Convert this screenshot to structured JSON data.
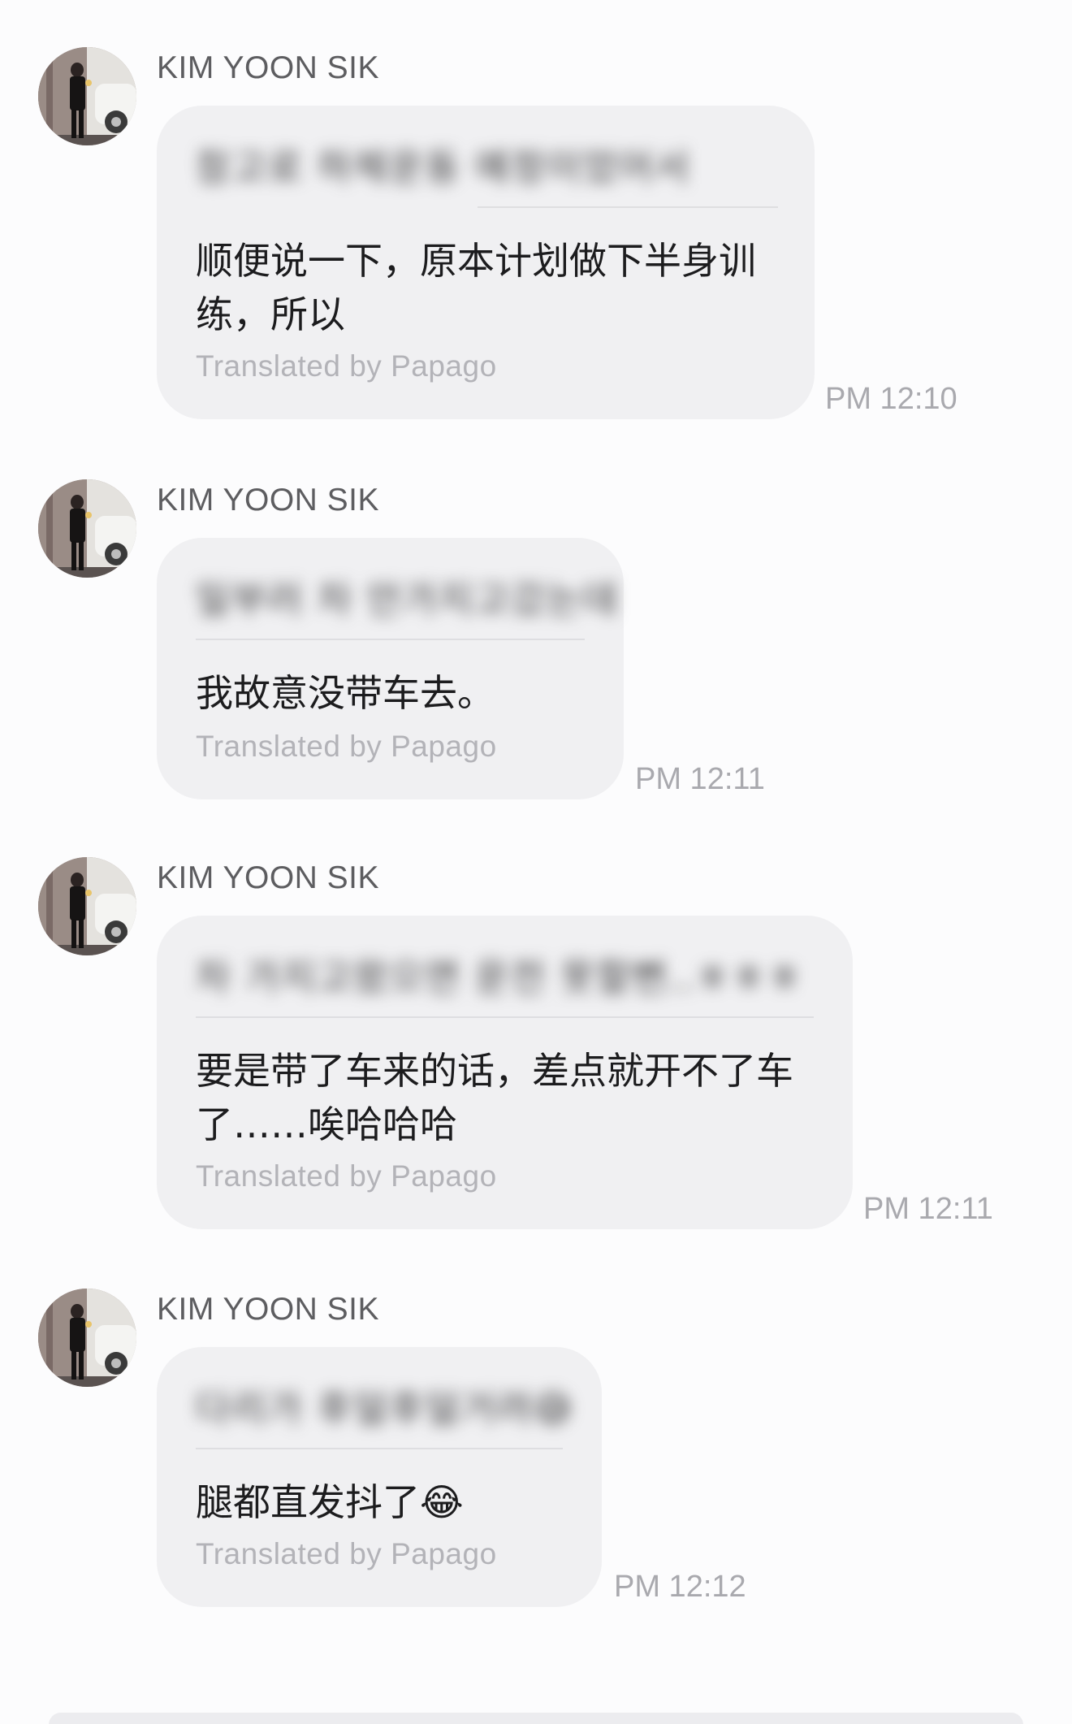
{
  "messages": [
    {
      "sender": "KIM YOON SIK",
      "original_text": "참고로 하체운동 예정이었어서",
      "translated_text": "顺便说一下，原本计划做下半身训练，所以",
      "credit": "Translated by Papago",
      "time": "PM 12:10"
    },
    {
      "sender": "KIM YOON SIK",
      "original_text": "일부러 차 안가지고갔는데",
      "translated_text": "我故意没带车去。",
      "credit": "Translated by Papago",
      "time": "PM 12:11"
    },
    {
      "sender": "KIM YOON SIK",
      "original_text": "차 가지고왔으면 운전 못할뻔..ㅎㅎㅎ",
      "translated_text": "要是带了车来的话，差点就开不了车了……唉哈哈哈",
      "credit": "Translated by Papago",
      "time": "PM 12:11"
    },
    {
      "sender": "KIM YOON SIK",
      "original_text": "다리가 후덜후덜거려😅",
      "translated_text": "腿都直发抖了😂",
      "credit": "Translated by Papago",
      "time": "PM 12:12"
    }
  ]
}
